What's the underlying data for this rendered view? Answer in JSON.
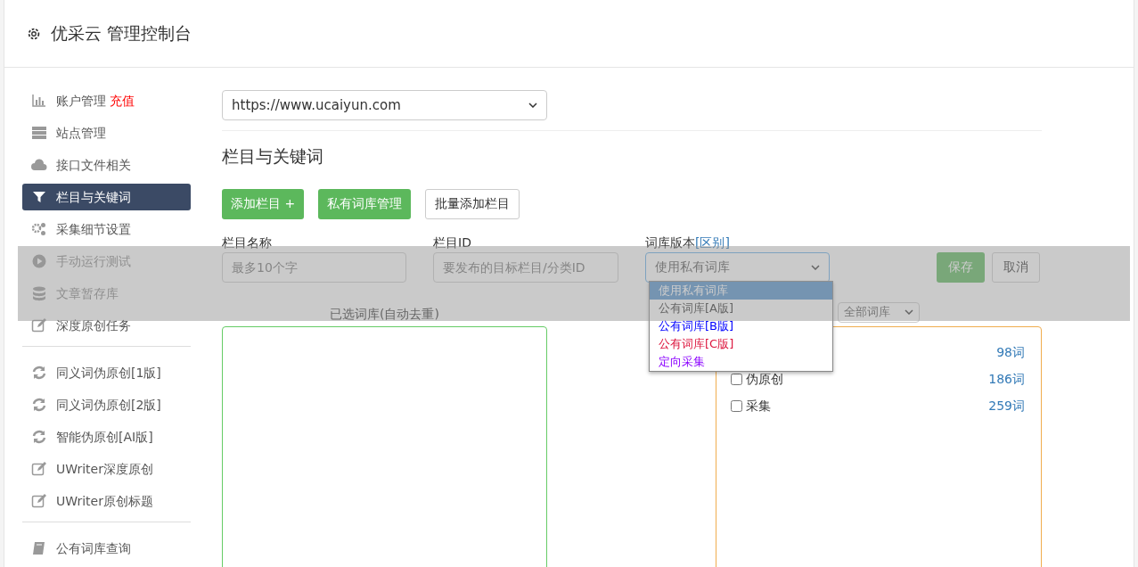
{
  "header": {
    "title": "优采云 管理控制台"
  },
  "sidebar": {
    "groups": [
      {
        "items": [
          {
            "label": "账户管理",
            "badge": "充值",
            "selected": false,
            "dimmed": false
          },
          {
            "label": "站点管理",
            "selected": false,
            "dimmed": false
          },
          {
            "label": "接口文件相关",
            "selected": false,
            "dimmed": false
          },
          {
            "label": "栏目与关键词",
            "selected": true,
            "dimmed": false
          },
          {
            "label": "采集细节设置",
            "selected": false,
            "dimmed": false
          },
          {
            "label": "手动运行测试",
            "selected": false,
            "dimmed": true
          },
          {
            "label": "文章暂存库",
            "selected": false,
            "dimmed": true
          },
          {
            "label": "深度原创任务",
            "selected": false,
            "dimmed": false
          }
        ]
      },
      {
        "items": [
          {
            "label": "同义词伪原创[1版]",
            "selected": false,
            "dimmed": false
          },
          {
            "label": "同义词伪原创[2版]",
            "selected": false,
            "dimmed": false
          },
          {
            "label": "智能伪原创[AI版]",
            "selected": false,
            "dimmed": false
          },
          {
            "label": "UWriter深度原创",
            "selected": false,
            "dimmed": false
          },
          {
            "label": "UWriter原创标题",
            "selected": false,
            "dimmed": false
          }
        ]
      },
      {
        "items": [
          {
            "label": "公有词库查询",
            "selected": false,
            "dimmed": false
          }
        ]
      }
    ]
  },
  "site_select": {
    "value": "https://www.ucaiyun.com"
  },
  "section_title": "栏目与关键词",
  "actions": [
    {
      "label": "添加栏目 +",
      "kind": "primary"
    },
    {
      "label": "私有词库管理",
      "kind": "primary"
    },
    {
      "label": "批量添加栏目",
      "kind": "secondary"
    }
  ],
  "form": {
    "name": {
      "label": "栏目名称",
      "placeholder": "最多10个字"
    },
    "id": {
      "label": "栏目ID",
      "placeholder": "要发布的目标栏目/分类ID"
    },
    "library": {
      "label": "词库版本",
      "link": "[区别]",
      "value": "使用私有词库",
      "options": [
        {
          "label": "使用私有词库",
          "selected": true
        },
        {
          "label": "公有词库[A版]",
          "selected": false
        },
        {
          "label": "公有词库[B版]",
          "selected": false,
          "color": "#0000ff"
        },
        {
          "label": "公有词库[C版]",
          "selected": false,
          "color": "#dc143c"
        },
        {
          "label": "定向采集",
          "selected": false,
          "color": "#8b00ff"
        }
      ]
    },
    "save": "保存",
    "cancel": "取消"
  },
  "selected_panel": {
    "title": "已选词库(自动去重)"
  },
  "library_filter": {
    "value": "全部词库"
  },
  "libraries": [
    {
      "count": "98词"
    },
    {
      "label": "伪原创",
      "count": "186词",
      "checked": false
    },
    {
      "label": "采集",
      "count": "259词",
      "checked": false
    }
  ]
}
